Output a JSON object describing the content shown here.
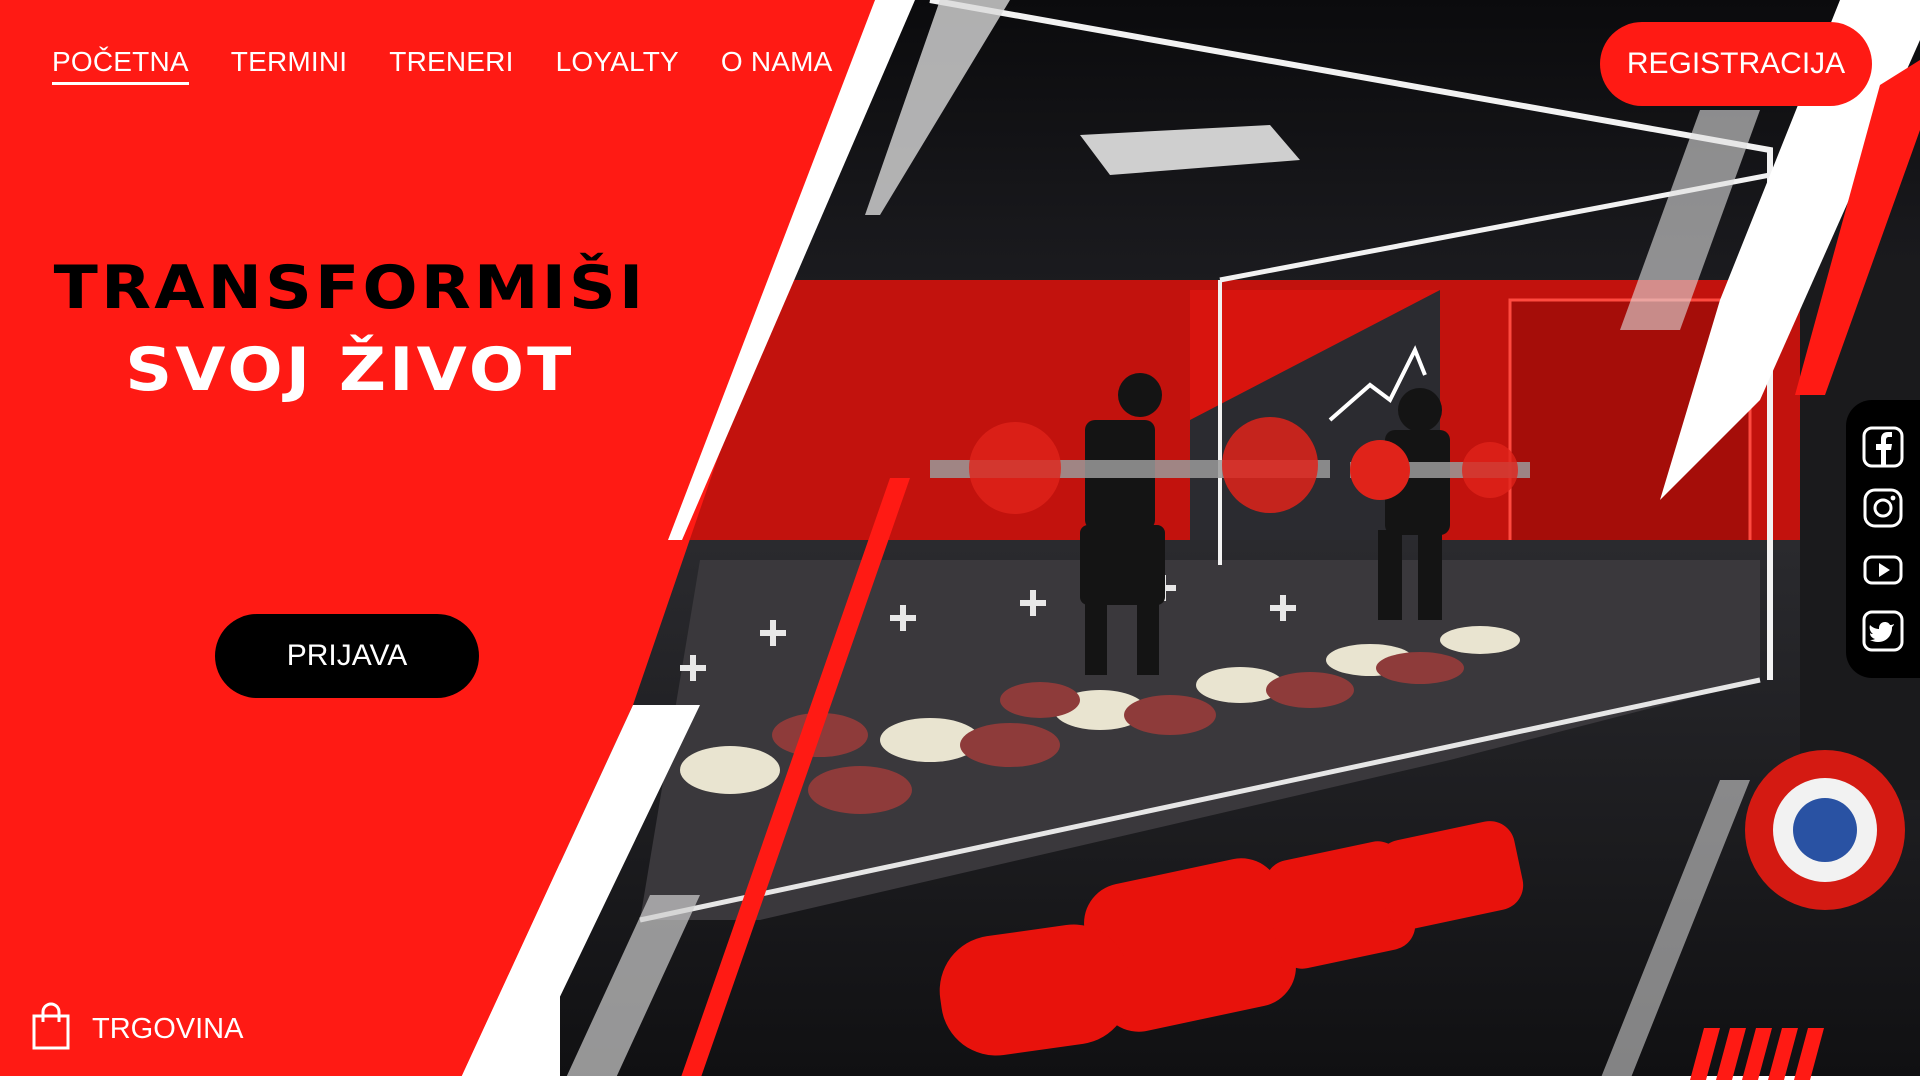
{
  "nav": {
    "items": [
      {
        "label": "POČETNA",
        "active": true
      },
      {
        "label": "TERMINI",
        "active": false
      },
      {
        "label": "TRENERI",
        "active": false
      },
      {
        "label": "LOYALTY",
        "active": false
      },
      {
        "label": "O NAMA",
        "active": false
      }
    ],
    "register_label": "REGISTRACIJA"
  },
  "hero": {
    "headline_line1": "TRANSFORMIŠI",
    "headline_line2": "SVOJ ŽIVOT",
    "login_label": "PRIJAVA"
  },
  "shop": {
    "label": "TRGOVINA",
    "icon": "shopping-bag-icon"
  },
  "social": {
    "icons": [
      "facebook-icon",
      "instagram-icon",
      "youtube-icon",
      "twitter-icon"
    ]
  },
  "colors": {
    "brand_red": "#ff1a14",
    "black": "#000000",
    "white": "#ffffff"
  }
}
